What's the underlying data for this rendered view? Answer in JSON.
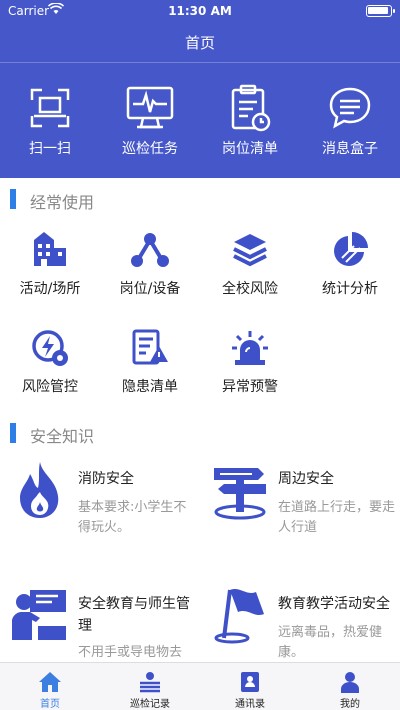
{
  "status_bar": {
    "carrier": "Carrier",
    "time": "11:30 AM"
  },
  "header": {
    "title": "首页"
  },
  "quick_actions": [
    {
      "label": "扫一扫",
      "icon": "scan-icon"
    },
    {
      "label": "巡检任务",
      "icon": "monitor-icon"
    },
    {
      "label": "岗位清单",
      "icon": "clipboard-clock-icon"
    },
    {
      "label": "消息盒子",
      "icon": "message-icon"
    }
  ],
  "section_frequent": {
    "title": "经常使用"
  },
  "frequent_items": [
    {
      "label": "活动/场所",
      "icon": "building-icon"
    },
    {
      "label": "岗位/设备",
      "icon": "network-icon"
    },
    {
      "label": "全校风险",
      "icon": "layers-icon"
    },
    {
      "label": "统计分析",
      "icon": "pie-chart-icon"
    },
    {
      "label": "风险管控",
      "icon": "risk-gear-icon"
    },
    {
      "label": "隐患清单",
      "icon": "hazard-list-icon"
    },
    {
      "label": "异常预警",
      "icon": "alarm-icon"
    }
  ],
  "section_knowledge": {
    "title": "安全知识"
  },
  "knowledge_cards": [
    {
      "title": "消防安全",
      "desc": "基本要求:小学生不得玩火。",
      "icon": "fire-icon"
    },
    {
      "title": "周边安全",
      "desc": "在道路上行走，要走人行道",
      "icon": "signpost-icon"
    },
    {
      "title": "安全教育与师生管理",
      "desc": "不用手或导电物去",
      "icon": "teacher-icon"
    },
    {
      "title": "教育教学活动安全",
      "desc": "远离毒品，热爱健康。",
      "icon": "flag-icon"
    }
  ],
  "tabbar": [
    {
      "label": "首页",
      "icon": "home-icon",
      "active": true
    },
    {
      "label": "巡检记录",
      "icon": "records-icon",
      "active": false
    },
    {
      "label": "通讯录",
      "icon": "contacts-icon",
      "active": false
    },
    {
      "label": "我的",
      "icon": "user-icon",
      "active": false
    }
  ],
  "colors": {
    "header": "#4658c9",
    "icon_blue": "#3f51c8",
    "accent": "#2e7ee8",
    "tab_active": "#3d7fe0"
  }
}
